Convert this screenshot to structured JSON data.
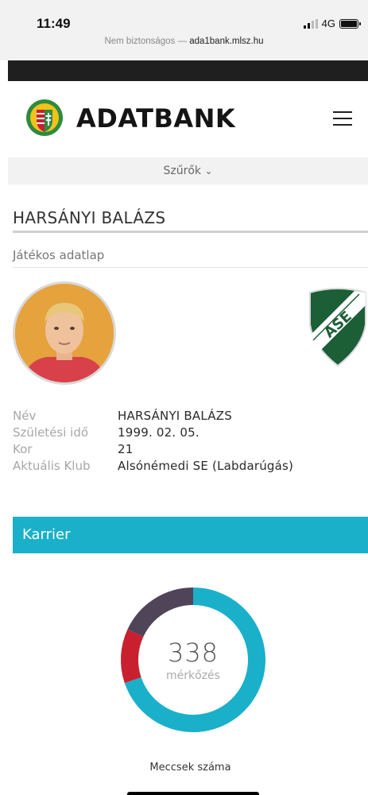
{
  "status": {
    "time": "11:49",
    "network": "4G"
  },
  "browser": {
    "security_text": "Nem biztonságos —",
    "domain": "ada1bank.mlsz.hu"
  },
  "header": {
    "brand": "ADATBANK"
  },
  "filters": {
    "label": "Szűrők",
    "chevron": "⌄"
  },
  "player": {
    "name": "HARSÁNYI BALÁZS",
    "subtitle": "Játékos adatlap",
    "info": [
      {
        "label": "Név",
        "value": "HARSÁNYI BALÁZS"
      },
      {
        "label": "Születési idő",
        "value": "1999. 02. 05."
      },
      {
        "label": "Kor",
        "value": "21"
      },
      {
        "label": "Aktuális Klub",
        "value": "Alsónémedi SE (Labdarúgás)"
      }
    ]
  },
  "career": {
    "title": "Karrier"
  },
  "chart_data": {
    "type": "pie",
    "center_value": "338",
    "center_label": "mérkőzés",
    "caption": "Meccsek száma",
    "slices": [
      {
        "value": 236,
        "color": "#1ab0c9"
      },
      {
        "value": 41,
        "color": "#c8202f"
      },
      {
        "value": 61,
        "color": "#4f4458"
      }
    ]
  },
  "colors": {
    "accent": "#1ab0c9",
    "dark": "#1f1f1f"
  }
}
